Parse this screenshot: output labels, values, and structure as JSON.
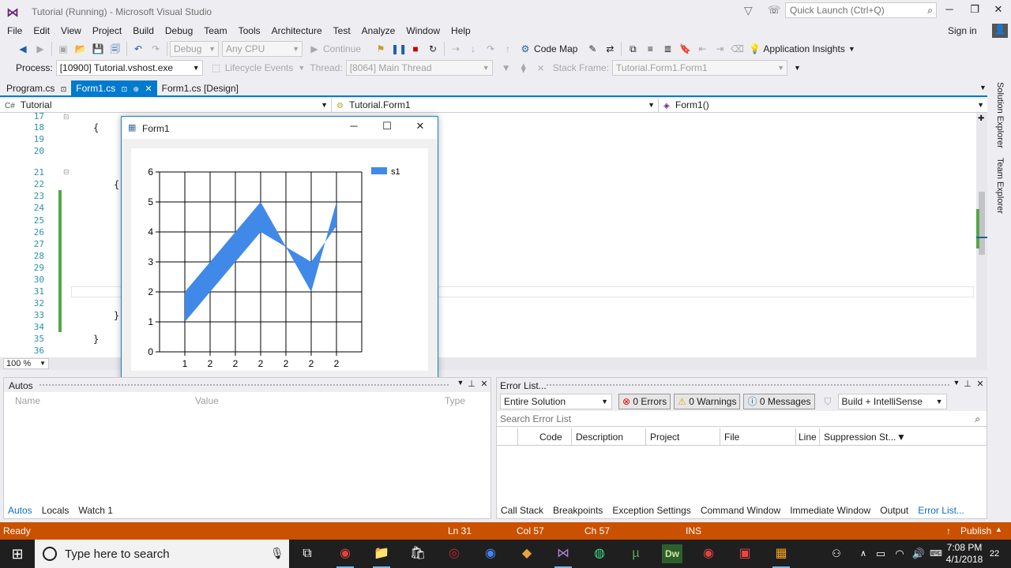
{
  "window": {
    "title": "Tutorial (Running) - Microsoft Visual Studio",
    "quick_launch_placeholder": "Quick Launch (Ctrl+Q)",
    "sign_in": "Sign in"
  },
  "menu": [
    "File",
    "Edit",
    "View",
    "Project",
    "Build",
    "Debug",
    "Team",
    "Tools",
    "Architecture",
    "Test",
    "Analyze",
    "Window",
    "Help"
  ],
  "toolbar": {
    "config": "Debug",
    "platform": "Any CPU",
    "continue": "Continue",
    "code_map": "Code Map",
    "app_insights": "Application Insights"
  },
  "debug_toolbar": {
    "process_label": "Process:",
    "process_value": "[10900] Tutorial.vshost.exe",
    "lifecycle": "Lifecycle Events",
    "thread_label": "Thread:",
    "thread_value": "[8064] Main Thread",
    "stack_label": "Stack Frame:",
    "stack_value": "Tutorial.Form1.Form1"
  },
  "doc_tabs": [
    "Program.cs",
    "Form1.cs",
    "Form1.cs [Design]"
  ],
  "nav": {
    "project": "Tutorial",
    "class": "Tutorial.Form1",
    "member": "Form1()"
  },
  "editor": {
    "line_numbers": [
      "17",
      "18",
      "19",
      "20",
      "21",
      "22",
      "23",
      "24",
      "25",
      "26",
      "27",
      "28",
      "29",
      "30",
      "31",
      "32",
      "33",
      "34",
      "35",
      "36"
    ],
    "zoom": "100 %"
  },
  "form1": {
    "title": "Form1"
  },
  "chart_data": {
    "type": "area",
    "categories": [
      "1",
      "2",
      "2",
      "2",
      "2",
      "2",
      "2"
    ],
    "series": [
      {
        "name": "s1",
        "lower": [
          1,
          null,
          null,
          4,
          null,
          2,
          5
        ],
        "upper": [
          2,
          null,
          null,
          5,
          null,
          3,
          5
        ]
      }
    ],
    "band_points": [
      [
        1,
        1
      ],
      [
        1,
        2
      ],
      [
        4,
        5
      ],
      [
        6,
        2
      ],
      [
        7,
        5
      ],
      [
        7,
        4.2
      ],
      [
        6,
        3
      ],
      [
        4,
        4
      ],
      [
        1,
        1
      ]
    ],
    "y_ticks": [
      "0",
      "1",
      "2",
      "3",
      "4",
      "5",
      "6"
    ],
    "ylim": [
      0,
      6
    ],
    "x_count": 8,
    "legend": "top-right",
    "grid": true,
    "color": "#4189e8"
  },
  "autos": {
    "title": "Autos",
    "columns": [
      "Name",
      "Value",
      "Type"
    ],
    "tabs": [
      "Autos",
      "Locals",
      "Watch 1"
    ]
  },
  "error_list": {
    "title": "Error List...",
    "scope": "Entire Solution",
    "errors": "0 Errors",
    "warnings": "0 Warnings",
    "messages": "0 Messages",
    "build_filter": "Build + IntelliSense",
    "search_placeholder": "Search Error List",
    "columns": [
      "Code",
      "Description",
      "Project",
      "File",
      "Line",
      "Suppression St..."
    ],
    "tabs": [
      "Call Stack",
      "Breakpoints",
      "Exception Settings",
      "Command Window",
      "Immediate Window",
      "Output",
      "Error List..."
    ]
  },
  "status": {
    "ready": "Ready",
    "ln": "Ln 31",
    "col": "Col 57",
    "ch": "Ch 57",
    "ins": "INS",
    "publish": "Publish"
  },
  "right_rail": [
    "Solution Explorer",
    "Team Explorer"
  ],
  "taskbar": {
    "search_placeholder": "Type here to search",
    "time": "7:08 PM",
    "date": "4/1/2018",
    "notifications": "22"
  }
}
